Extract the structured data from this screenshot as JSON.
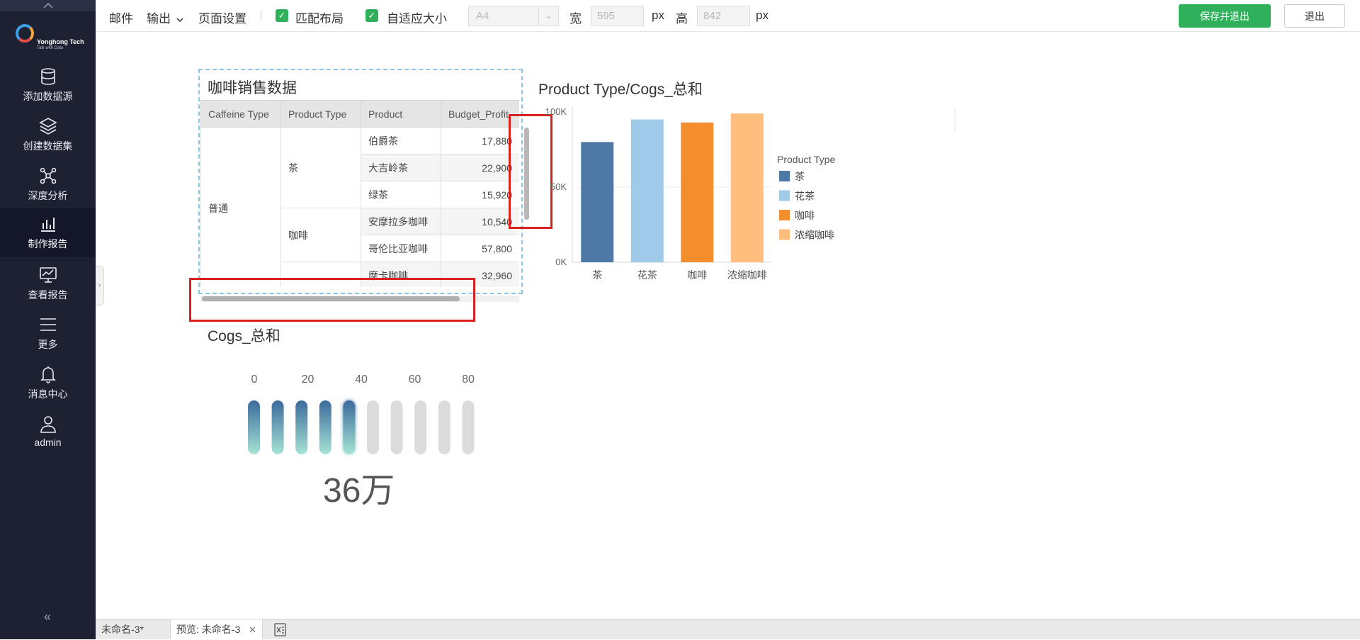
{
  "sidebar": {
    "logo": {
      "name": "Yonghong Tech",
      "tagline": "Talk with Data"
    },
    "items": [
      {
        "label": "添加数据源",
        "icon": "database-icon"
      },
      {
        "label": "创建数据集",
        "icon": "layers-icon"
      },
      {
        "label": "深度分析",
        "icon": "network-icon"
      },
      {
        "label": "制作报告",
        "icon": "bar-chart-icon",
        "active": true
      },
      {
        "label": "查看报告",
        "icon": "monitor-chart-icon"
      },
      {
        "label": "更多",
        "icon": "menu-icon"
      },
      {
        "label": "消息中心",
        "icon": "bell-icon"
      },
      {
        "label": "admin",
        "icon": "user-icon"
      }
    ]
  },
  "toolbar": {
    "mail": "邮件",
    "export": "输出",
    "page_settings": "页面设置",
    "fit_layout": "匹配布局",
    "auto_size": "自适应大小",
    "paper_size": "A4",
    "width_label": "宽",
    "width_value": "595",
    "height_label": "高",
    "height_value": "842",
    "unit": "px",
    "save_exit": "保存并退出",
    "exit": "退出"
  },
  "table_widget": {
    "title": "咖啡销售数据",
    "columns": [
      "Caffeine Type",
      "Product Type",
      "Product",
      "Budget_Profit"
    ],
    "caffeine_type": "普通",
    "product_types": [
      "茶",
      "咖啡"
    ],
    "rows": [
      {
        "product": "伯爵茶",
        "value": "17,880"
      },
      {
        "product": "大吉岭茶",
        "value": "22,900"
      },
      {
        "product": "绿茶",
        "value": "15,920"
      },
      {
        "product": "安摩拉多咖啡",
        "value": "10,540"
      },
      {
        "product": "哥伦比亚咖啡",
        "value": "57,800"
      },
      {
        "product": "摩卡咖啡",
        "value": "32,960"
      }
    ]
  },
  "bar_chart": {
    "title": "Product Type/Cogs_总和",
    "legend_title": "Product Type",
    "y_ticks": [
      "100K",
      "50K",
      "0K"
    ],
    "categories": [
      "茶",
      "花茶",
      "咖啡",
      "浓缩咖啡"
    ],
    "colors": [
      "#4e79a7",
      "#a0cbe8",
      "#f28e2b",
      "#ffbe7d"
    ]
  },
  "chart_data": {
    "type": "bar",
    "title": "Product Type/Cogs_总和",
    "categories": [
      "茶",
      "花茶",
      "咖啡",
      "浓缩咖啡"
    ],
    "values": [
      80000,
      95000,
      93000,
      99000
    ],
    "ylim": [
      0,
      100000
    ],
    "legend_title": "Product Type",
    "legend_placement": "right",
    "grid": true
  },
  "gauge": {
    "title": "Cogs_总和",
    "ticks": [
      "0",
      "20",
      "40",
      "60",
      "80"
    ],
    "value_label": "36万",
    "filled_segments": 5,
    "total_segments": 10
  },
  "bottom_tabs": {
    "tab1": "未命名-3*",
    "tab2": "预览: 未命名-3"
  }
}
